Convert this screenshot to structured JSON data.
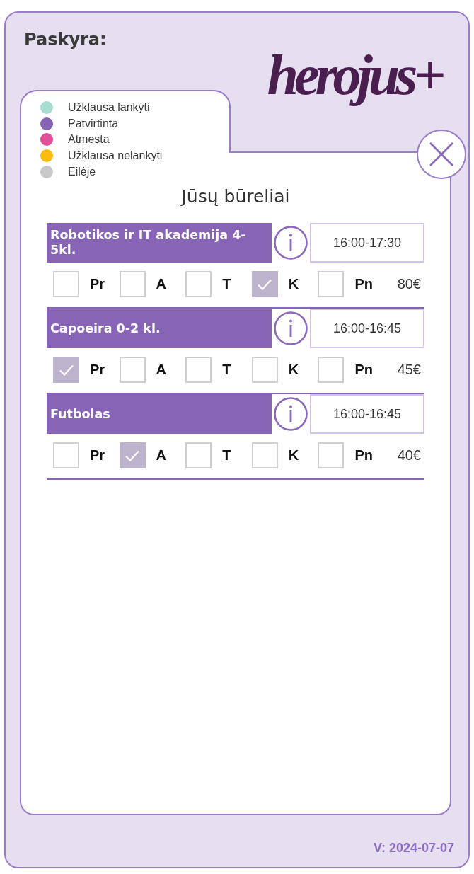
{
  "header": {
    "title": "Paskyra:",
    "logo": "herojus+"
  },
  "legend": [
    {
      "label": "Užklausa lankyti",
      "color": "#a9dcd2"
    },
    {
      "label": "Patvirtinta",
      "color": "#8763b5"
    },
    {
      "label": "Atmesta",
      "color": "#e2509a"
    },
    {
      "label": "Užklausa nelankyti",
      "color": "#fbbb0f"
    },
    {
      "label": "Eilėje",
      "color": "#c8c8c8"
    }
  ],
  "panel": {
    "title": "Jūsų būreliai",
    "activities": [
      {
        "name": "Robotikos ir IT akademija 4-5kl.",
        "time": "16:00-17:30",
        "price": "80€",
        "days": [
          {
            "label": "Pr",
            "checked": false
          },
          {
            "label": "A",
            "checked": false
          },
          {
            "label": "T",
            "checked": false
          },
          {
            "label": "K",
            "checked": true
          },
          {
            "label": "Pn",
            "checked": false
          }
        ]
      },
      {
        "name": "Capoeira 0-2 kl.",
        "time": "16:00-16:45",
        "price": "45€",
        "days": [
          {
            "label": "Pr",
            "checked": true
          },
          {
            "label": "A",
            "checked": false
          },
          {
            "label": "T",
            "checked": false
          },
          {
            "label": "K",
            "checked": false
          },
          {
            "label": "Pn",
            "checked": false
          }
        ]
      },
      {
        "name": "Futbolas",
        "time": "16:00-16:45",
        "price": "40€",
        "days": [
          {
            "label": "Pr",
            "checked": false
          },
          {
            "label": "A",
            "checked": true
          },
          {
            "label": "T",
            "checked": false
          },
          {
            "label": "K",
            "checked": false
          },
          {
            "label": "Pn",
            "checked": false
          }
        ]
      }
    ]
  },
  "footer": {
    "version": "V: 2024-07-07"
  }
}
